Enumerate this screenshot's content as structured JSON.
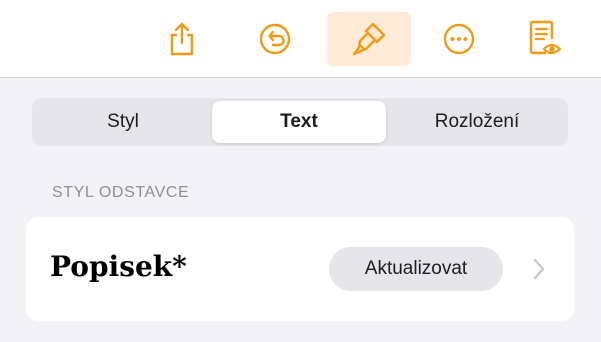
{
  "toolbar": {
    "accent": "#f29a13",
    "active_bg": "#fdebd7",
    "buttons": [
      {
        "icon": "share-icon"
      },
      {
        "icon": "undo-icon"
      },
      {
        "icon": "format-brush-icon",
        "active": true
      },
      {
        "icon": "more-icon"
      },
      {
        "icon": "reading-view-icon"
      }
    ]
  },
  "tabs": {
    "items": [
      "Styl",
      "Text",
      "Rozložení"
    ],
    "selected": "Text"
  },
  "section": {
    "title": "STYL ODSTAVCE"
  },
  "paragraph_style": {
    "name": "Popisek*",
    "update_label": "Aktualizovat",
    "chevron_icon": "chevron-right-icon"
  }
}
